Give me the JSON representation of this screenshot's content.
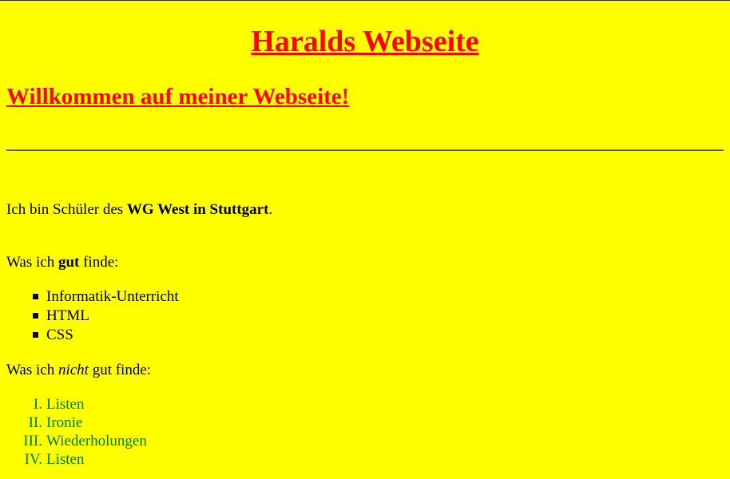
{
  "header": {
    "site_title": "Haralds Webseite",
    "welcome": "Willkommen auf meiner Webseite!"
  },
  "intro": {
    "prefix": "Ich bin Schüler des ",
    "school": "WG West in Stuttgart",
    "suffix": "."
  },
  "good": {
    "prefix": "Was ich ",
    "emphasis": "gut",
    "suffix": " finde:",
    "items": [
      "Informatik-Unterricht",
      "HTML",
      "CSS"
    ]
  },
  "bad": {
    "prefix": "Was ich ",
    "emphasis": "nicht",
    "suffix": " gut finde:",
    "items": [
      {
        "numeral": "I.",
        "label": "Listen"
      },
      {
        "numeral": "II.",
        "label": "Ironie"
      },
      {
        "numeral": "III.",
        "label": "Wiederholungen"
      },
      {
        "numeral": "IV.",
        "label": "Listen"
      }
    ]
  },
  "colors": {
    "background": "#ffff00",
    "heading": "#ff0000",
    "ordered_list": "#008000"
  }
}
